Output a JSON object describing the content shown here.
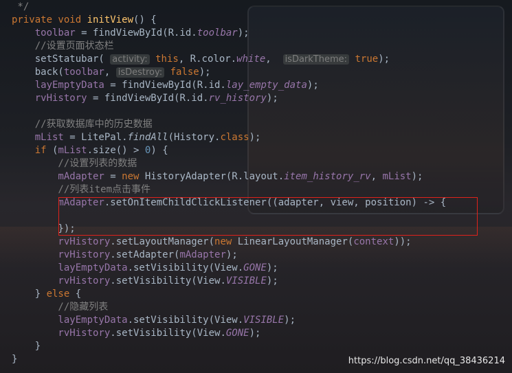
{
  "code_lines": [
    {
      "tokens": [
        {
          "text": " */",
          "cls": "cm"
        }
      ]
    },
    {
      "tokens": [
        {
          "text": "private void ",
          "cls": "kw"
        },
        {
          "text": "initView",
          "cls": "fn"
        },
        {
          "text": "() {",
          "cls": "tx"
        }
      ]
    },
    {
      "tokens": [
        {
          "text": "    toolbar",
          "cls": "fld"
        },
        {
          "text": " = findViewById(R.id.",
          "cls": "tx"
        },
        {
          "text": "toolbar",
          "cls": "fldi"
        },
        {
          "text": ");",
          "cls": "tx"
        }
      ]
    },
    {
      "tokens": [
        {
          "text": "    //设置页面状态栏",
          "cls": "cm"
        }
      ]
    },
    {
      "tokens": [
        {
          "text": "    setStatubar( ",
          "cls": "tx"
        },
        {
          "text": "activity:",
          "cls": "hint"
        },
        {
          "text": " this",
          "cls": "kw"
        },
        {
          "text": ", R.color.",
          "cls": "tx"
        },
        {
          "text": "white",
          "cls": "fldi"
        },
        {
          "text": ",  ",
          "cls": "tx"
        },
        {
          "text": "isDarkTheme:",
          "cls": "hint"
        },
        {
          "text": " true",
          "cls": "kw"
        },
        {
          "text": ");",
          "cls": "tx"
        }
      ]
    },
    {
      "tokens": [
        {
          "text": "    back(",
          "cls": "tx"
        },
        {
          "text": "toolbar",
          "cls": "fld"
        },
        {
          "text": ", ",
          "cls": "tx"
        },
        {
          "text": "isDestroy:",
          "cls": "hint"
        },
        {
          "text": " false",
          "cls": "kw"
        },
        {
          "text": ");",
          "cls": "tx"
        }
      ]
    },
    {
      "tokens": [
        {
          "text": "    layEmptyData",
          "cls": "fld"
        },
        {
          "text": " = findViewById(R.id.",
          "cls": "tx"
        },
        {
          "text": "lay_empty_data",
          "cls": "fldi"
        },
        {
          "text": ");",
          "cls": "tx"
        }
      ]
    },
    {
      "tokens": [
        {
          "text": "    rvHistory",
          "cls": "fld"
        },
        {
          "text": " = findViewById(R.id.",
          "cls": "tx"
        },
        {
          "text": "rv_history",
          "cls": "fldi"
        },
        {
          "text": ");",
          "cls": "tx"
        }
      ]
    },
    {
      "tokens": [
        {
          "text": "",
          "cls": "tx"
        }
      ]
    },
    {
      "tokens": [
        {
          "text": "    //获取数据库中的历史数据",
          "cls": "cm"
        }
      ]
    },
    {
      "tokens": [
        {
          "text": "    mList",
          "cls": "fld"
        },
        {
          "text": " = LitePal.",
          "cls": "tx"
        },
        {
          "text": "findAll",
          "cls": "stat"
        },
        {
          "text": "(History.",
          "cls": "tx"
        },
        {
          "text": "class",
          "cls": "kw"
        },
        {
          "text": ");",
          "cls": "tx"
        }
      ]
    },
    {
      "tokens": [
        {
          "text": "    if ",
          "cls": "kw"
        },
        {
          "text": "(",
          "cls": "tx"
        },
        {
          "text": "mList",
          "cls": "fld"
        },
        {
          "text": ".size() > ",
          "cls": "tx"
        },
        {
          "text": "0",
          "cls": "num"
        },
        {
          "text": ") {",
          "cls": "tx"
        }
      ]
    },
    {
      "tokens": [
        {
          "text": "        //设置列表的数据",
          "cls": "cm"
        }
      ]
    },
    {
      "tokens": [
        {
          "text": "        mAdapter",
          "cls": "fld"
        },
        {
          "text": " = ",
          "cls": "tx"
        },
        {
          "text": "new ",
          "cls": "kw"
        },
        {
          "text": "HistoryAdapter(R.layout.",
          "cls": "tx"
        },
        {
          "text": "item_history_rv",
          "cls": "fldi"
        },
        {
          "text": ", ",
          "cls": "tx"
        },
        {
          "text": "mList",
          "cls": "fld"
        },
        {
          "text": ");",
          "cls": "tx"
        }
      ]
    },
    {
      "tokens": [
        {
          "text": "        //列表item点击事件",
          "cls": "cm"
        }
      ]
    },
    {
      "tokens": [
        {
          "text": "        mAdapter",
          "cls": "fld"
        },
        {
          "text": ".setOnItemChildClickListener((adapter, view, position) -> {",
          "cls": "tx"
        }
      ]
    },
    {
      "tokens": [
        {
          "text": "",
          "cls": "tx"
        }
      ]
    },
    {
      "tokens": [
        {
          "text": "        });",
          "cls": "tx"
        }
      ]
    },
    {
      "tokens": [
        {
          "text": "        rvHistory",
          "cls": "fld"
        },
        {
          "text": ".setLayoutManager(",
          "cls": "tx"
        },
        {
          "text": "new ",
          "cls": "kw"
        },
        {
          "text": "LinearLayoutManager(",
          "cls": "tx"
        },
        {
          "text": "context",
          "cls": "fld"
        },
        {
          "text": "));",
          "cls": "tx"
        }
      ]
    },
    {
      "tokens": [
        {
          "text": "        rvHistory",
          "cls": "fld"
        },
        {
          "text": ".setAdapter(",
          "cls": "tx"
        },
        {
          "text": "mAdapter",
          "cls": "fld"
        },
        {
          "text": ");",
          "cls": "tx"
        }
      ]
    },
    {
      "tokens": [
        {
          "text": "        layEmptyData",
          "cls": "fld"
        },
        {
          "text": ".setVisibility(View.",
          "cls": "tx"
        },
        {
          "text": "GONE",
          "cls": "fldi"
        },
        {
          "text": ");",
          "cls": "tx"
        }
      ]
    },
    {
      "tokens": [
        {
          "text": "        rvHistory",
          "cls": "fld"
        },
        {
          "text": ".setVisibility(View.",
          "cls": "tx"
        },
        {
          "text": "VISIBLE",
          "cls": "fldi"
        },
        {
          "text": ");",
          "cls": "tx"
        }
      ]
    },
    {
      "tokens": [
        {
          "text": "    } ",
          "cls": "tx"
        },
        {
          "text": "else ",
          "cls": "kw"
        },
        {
          "text": "{",
          "cls": "tx"
        }
      ]
    },
    {
      "tokens": [
        {
          "text": "        //隐藏列表",
          "cls": "cm"
        }
      ]
    },
    {
      "tokens": [
        {
          "text": "        layEmptyData",
          "cls": "fld"
        },
        {
          "text": ".setVisibility(View.",
          "cls": "tx"
        },
        {
          "text": "VISIBLE",
          "cls": "fldi"
        },
        {
          "text": ");",
          "cls": "tx"
        }
      ]
    },
    {
      "tokens": [
        {
          "text": "        rvHistory",
          "cls": "fld"
        },
        {
          "text": ".setVisibility(View.",
          "cls": "tx"
        },
        {
          "text": "GONE",
          "cls": "fldi"
        },
        {
          "text": ");",
          "cls": "tx"
        }
      ]
    },
    {
      "tokens": [
        {
          "text": "    }",
          "cls": "tx"
        }
      ]
    },
    {
      "tokens": [
        {
          "text": "}",
          "cls": "tx"
        }
      ]
    }
  ],
  "watermark": "https://blog.csdn.net/qq_38436214",
  "colors": {
    "keyword": "#cc7832",
    "method": "#ffc66d",
    "text": "#a9b7c6",
    "field": "#9876aa",
    "comment": "#808080",
    "number": "#6897bb",
    "highlight_box": "#e0221b"
  }
}
